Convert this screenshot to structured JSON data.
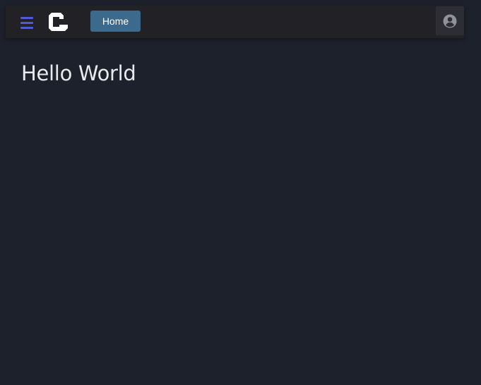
{
  "header": {
    "menu_icon": "hamburger-menu-icon",
    "logo_icon": "brand-logo-icon",
    "home_label": "Home",
    "account_icon": "account-circle-icon"
  },
  "main": {
    "title": "Hello World"
  },
  "colors": {
    "background": "#1d212b",
    "topbar": "#222226",
    "menu_accent": "#4f5bd5",
    "home_button": "#3b6a8d",
    "account_button": "#2d2e33",
    "text": "#e8e9ec"
  }
}
